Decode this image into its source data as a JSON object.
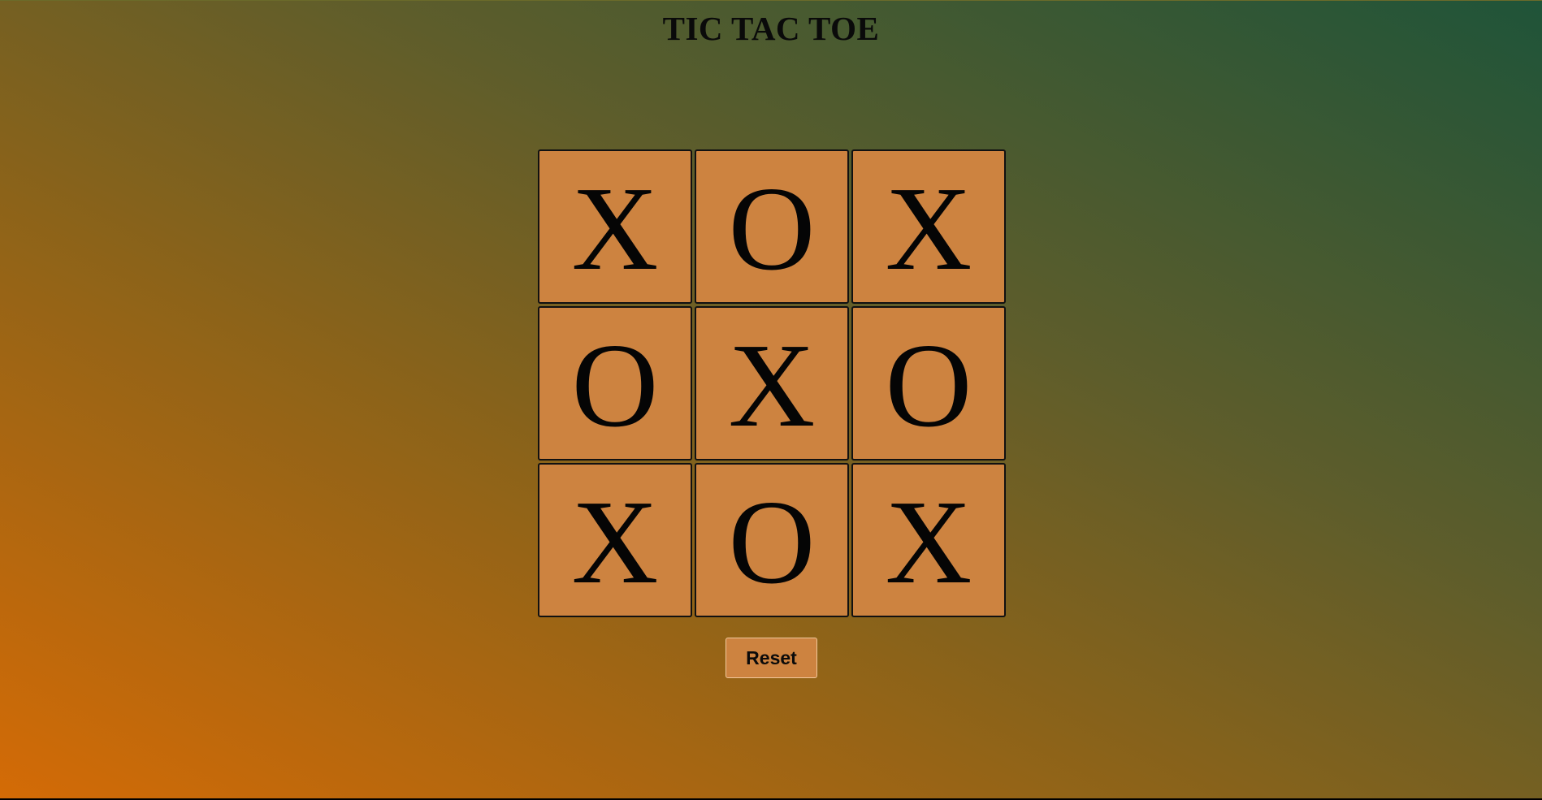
{
  "title": "TIC TAC TOE",
  "board": {
    "cells": [
      "X",
      "O",
      "X",
      "O",
      "X",
      "O",
      "X",
      "O",
      "X"
    ]
  },
  "reset_label": "Reset",
  "colors": {
    "cell_background": "#cd8340",
    "gradient_bottom_left": "#d46b06",
    "gradient_top_right": "#1f5439"
  }
}
